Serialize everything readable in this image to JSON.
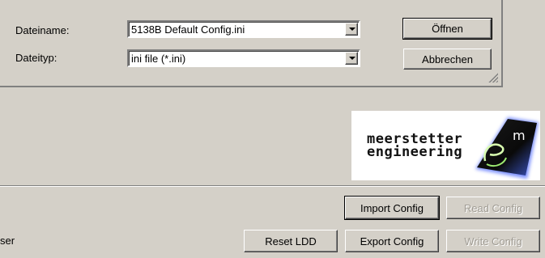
{
  "dialog": {
    "filename_label": "Dateiname:",
    "filename_value": "5138B Default Config.ini",
    "filetype_label": "Dateityp:",
    "filetype_value": "ini file (*.ini)",
    "open_button": "Öffnen",
    "cancel_button": "Abbrechen"
  },
  "logo": {
    "line1": "meerstetter",
    "line2": "engineering",
    "mark": "m"
  },
  "bottom": {
    "status_text": "ser",
    "import_config": "Import Config",
    "read_config": "Read Config",
    "reset_ldd": "Reset LDD",
    "export_config": "Export Config",
    "write_config": "Write Config"
  }
}
